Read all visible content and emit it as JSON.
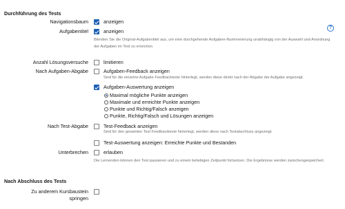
{
  "section_execution": {
    "title": "Durchführung des Tests"
  },
  "navigation_tree": {
    "label": "Navigationsbaum",
    "option": "anzeigen",
    "checked": true
  },
  "task_title": {
    "label": "Aufgabentitel",
    "option": "anzeigen",
    "checked": true,
    "info": "Blenden Sie die Original-Aufgabentitel aus, um eine durchgehende Aufgaben-Nummerierung unabhängig von der Auswahl und Anordnung der Aufgaben im Test zu erreichen."
  },
  "help_icon": "?",
  "attempts": {
    "label": "Anzahl Lösungsversuche",
    "option": "limitieren",
    "checked": false
  },
  "after_submission": {
    "label": "Nach Aufgaben-Abgabe",
    "feedback_option": "Aufgaben-Feedback anzeigen",
    "feedback_checked": false,
    "feedback_info": "Sind für die einzelne Aufgabe Feedbacktexte hinterlegt, werden diese direkt nach der Abgabe der Aufgabe angezeigt.",
    "evaluation_option": "Aufgaben-Auswertung anzeigen",
    "evaluation_checked": true,
    "radios": [
      {
        "label": "Maximal mögliche Punkte anzeigen",
        "checked": true
      },
      {
        "label": "Maximale und erreichte Punkte anzeigen",
        "checked": false
      },
      {
        "label": "Punkte und Richtig/Falsch anzeigen",
        "checked": false
      },
      {
        "label": "Punkte, Richtig/Falsch und Lösungen anzeigen",
        "checked": false
      }
    ]
  },
  "after_test": {
    "label": "Nach Test-Abgabe",
    "feedback_option": "Test-Feedback anzeigen",
    "feedback_checked": false,
    "feedback_info": "Sind für den gesamten Test Feedbacktexte hinterlegt, werden diese nach Testabschluss angezeigt.",
    "evaluation_option": "Test-Auswertung anzeigen: Erreichte Punkte und Bestanden",
    "evaluation_checked": false
  },
  "interrupt": {
    "label": "Unterbrechen",
    "option": "erlauben",
    "checked": false,
    "info": "Die Lernenden können den Test pausieren und zu einem beliebigen Zeitpunkt fortsetzen. Die Ergebnisse werden zwischengespeichert."
  },
  "section_completion": {
    "title": "Nach Abschluss des Tests"
  },
  "goto_course": {
    "label_line1": "Zu anderem Kursbaustein",
    "label_line2": "springen",
    "checked": false
  }
}
